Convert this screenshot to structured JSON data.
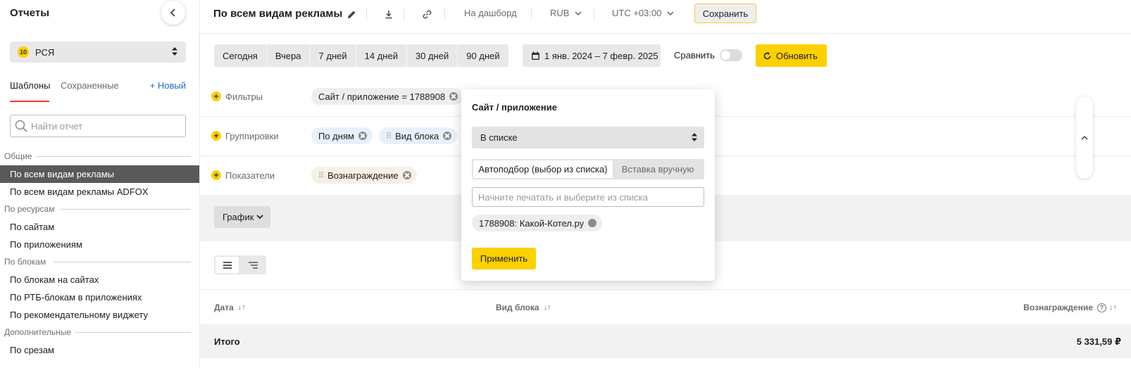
{
  "sidebar": {
    "title": "Отчеты",
    "product": {
      "badge": "10",
      "label": "РСЯ"
    },
    "tabs": {
      "templates": "Шаблоны",
      "saved": "Сохраненные",
      "new": "+ Новый"
    },
    "search_placeholder": "Найти отчет",
    "groups": [
      {
        "label": "Общие",
        "items": [
          "По всем видам рекламы",
          "По всем видам рекламы ADFOX"
        ]
      },
      {
        "label": "По ресурсам",
        "items": [
          "По сайтам",
          "По приложениям"
        ]
      },
      {
        "label": "По блокам",
        "items": [
          "По блокам на сайтах",
          "По РТБ-блокам в приложениях",
          "По рекомендательному виджету"
        ]
      },
      {
        "label": "Дополнительные",
        "items": [
          "По срезам"
        ]
      }
    ]
  },
  "topbar": {
    "title": "По всем видам рекламы",
    "dashboard": "На дашборд",
    "currency": "RUB",
    "timezone": "UTC +03:00",
    "save": "Сохранить"
  },
  "datebar": {
    "periods": [
      "Сегодня",
      "Вчера",
      "7 дней",
      "14 дней",
      "30 дней",
      "90 дней"
    ],
    "range": "1 янв. 2024 – 7 февр. 2025",
    "compare": "Сравнить",
    "refresh": "Обновить"
  },
  "rows": {
    "filters": {
      "label": "Фильтры",
      "chip": "Сайт / приложение = 1788908"
    },
    "groupings": {
      "label": "Группировки",
      "chips": [
        "По дням",
        "Вид блока"
      ]
    },
    "metrics": {
      "label": "Показатели",
      "chip": "Вознаграждение"
    }
  },
  "graph": {
    "label": "График"
  },
  "table": {
    "headers": {
      "date": "Дата",
      "block": "Вид блока",
      "reward": "Вознаграждение"
    },
    "total_label": "Итого",
    "total_value": "5 331,59 ₽"
  },
  "popup": {
    "title": "Сайт / приложение",
    "condition": "В списке",
    "tab_auto": "Автоподбор (выбор из списка)",
    "tab_manual": "Вставка вручную",
    "input_placeholder": "Начните печатать и выберите из списка",
    "selected": "1788908: Какой-Котел.ру",
    "apply": "Применить"
  },
  "colors": {
    "accent": "#fdd000",
    "active_item": "#595959",
    "tab_underline": "#ff3333",
    "link": "#2768c5"
  }
}
